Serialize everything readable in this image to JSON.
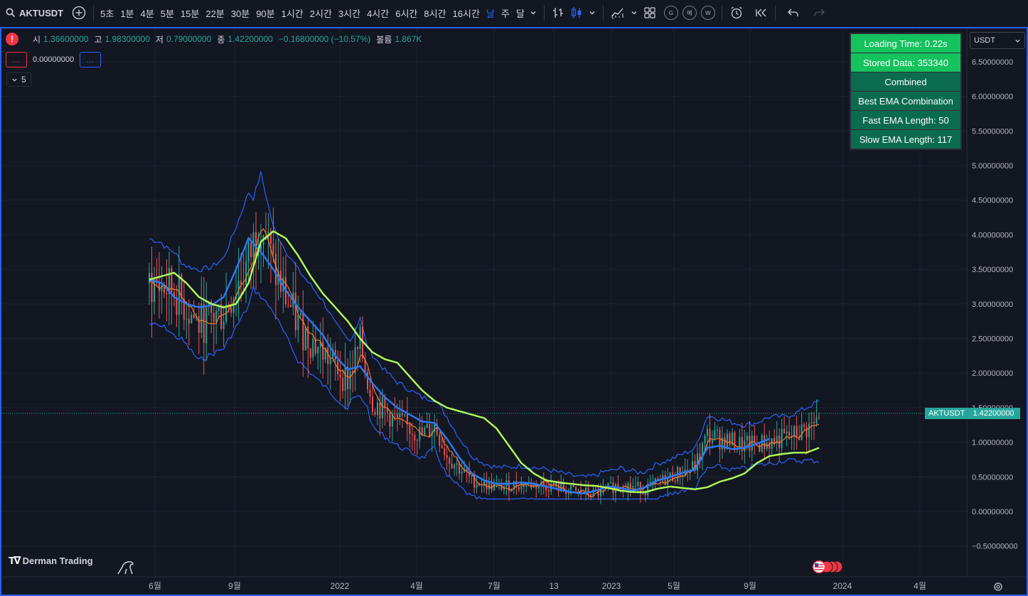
{
  "toolbar": {
    "symbol": "AKTUSDT",
    "intervals": [
      "5초",
      "1분",
      "4분",
      "5분",
      "15분",
      "22분",
      "30분",
      "90분",
      "1시간",
      "2시간",
      "3시간",
      "4시간",
      "6시간",
      "8시간",
      "16시간",
      "날",
      "주",
      "달"
    ],
    "active_interval": "날",
    "circle_buttons": [
      "G",
      "메",
      "W"
    ]
  },
  "legend": {
    "open_label": "시",
    "open_value": "1.36600000",
    "high_label": "고",
    "high_value": "1.98300000",
    "low_label": "저",
    "low_value": "0.79000000",
    "close_label": "종",
    "close_value": "1.42200000",
    "change": "−0.16800000 (−10.57%)",
    "volume_label": "볼륨",
    "volume_value": "1.867K",
    "indicator_value": "0.00000000",
    "dots": "…",
    "collapsed_count": "5"
  },
  "info_table": [
    {
      "text": "Loading Time: 0.22s",
      "style": "green"
    },
    {
      "text": "Stored Data: 353340",
      "style": "green"
    },
    {
      "text": "Combined",
      "style": "dark"
    },
    {
      "text": "Best EMA Combination",
      "style": "dark"
    },
    {
      "text": "Fast EMA Length: 50",
      "style": "dark"
    },
    {
      "text": "Slow EMA Length: 117",
      "style": "dark"
    }
  ],
  "currency": "USDT",
  "price_axis": [
    "6.50000000",
    "6.00000000",
    "5.50000000",
    "5.00000000",
    "4.50000000",
    "4.00000000",
    "3.50000000",
    "3.00000000",
    "2.50000000",
    "2.00000000",
    "1.50000000",
    "1.00000000",
    "0.50000000",
    "0.00000000",
    "−0.50000000"
  ],
  "time_axis": [
    "6월",
    "9월",
    "2022",
    "4월",
    "7월",
    "13",
    "2023",
    "5월",
    "9월",
    "2024",
    "4월"
  ],
  "last_price": {
    "symbol": "AKTUSDT",
    "price": "1.42200000"
  },
  "watermark": "Derman Trading",
  "colors": {
    "up": "#26a69a",
    "down": "#ef5350",
    "ema_green": "#b2ff59",
    "ema_blue": "#2979ff",
    "ema_orange": "#ff7f27",
    "band": "#2962ff",
    "accent": "#2962ff"
  },
  "chart_data": {
    "type": "line",
    "price_range": [
      -0.5,
      6.5
    ],
    "series": [
      {
        "points": [
          [
            0,
            3.35
          ],
          [
            5,
            3.4
          ],
          [
            10,
            3.45
          ],
          [
            15,
            3.3
          ],
          [
            20,
            3.1
          ],
          [
            25,
            3.0
          ],
          [
            30,
            2.95
          ],
          [
            35,
            3.0
          ],
          [
            40,
            3.3
          ],
          [
            45,
            3.9
          ],
          [
            50,
            4.05
          ],
          [
            55,
            3.95
          ],
          [
            60,
            3.7
          ],
          [
            65,
            3.4
          ],
          [
            70,
            3.15
          ],
          [
            75,
            2.95
          ],
          [
            80,
            2.75
          ],
          [
            85,
            2.5
          ],
          [
            90,
            2.3
          ],
          [
            95,
            2.2
          ],
          [
            100,
            2.15
          ],
          [
            105,
            1.95
          ],
          [
            110,
            1.75
          ],
          [
            115,
            1.6
          ],
          [
            120,
            1.5
          ],
          [
            125,
            1.45
          ],
          [
            130,
            1.4
          ],
          [
            135,
            1.35
          ],
          [
            140,
            1.2
          ],
          [
            145,
            0.95
          ],
          [
            150,
            0.7
          ],
          [
            155,
            0.55
          ],
          [
            160,
            0.45
          ],
          [
            165,
            0.42
          ],
          [
            170,
            0.4
          ],
          [
            175,
            0.38
          ],
          [
            180,
            0.37
          ],
          [
            185,
            0.34
          ],
          [
            190,
            0.3
          ],
          [
            195,
            0.28
          ],
          [
            200,
            0.28
          ],
          [
            205,
            0.33
          ],
          [
            210,
            0.36
          ],
          [
            215,
            0.34
          ],
          [
            220,
            0.32
          ],
          [
            225,
            0.35
          ],
          [
            230,
            0.43
          ],
          [
            235,
            0.48
          ],
          [
            240,
            0.55
          ],
          [
            245,
            0.7
          ],
          [
            250,
            0.8
          ],
          [
            255,
            0.83
          ],
          [
            260,
            0.85
          ],
          [
            265,
            0.85
          ],
          [
            270,
            0.92
          ]
        ]
      },
      {
        "points": [
          [
            0,
            3.35
          ],
          [
            5,
            3.3
          ],
          [
            10,
            3.1
          ],
          [
            15,
            3.0
          ],
          [
            20,
            2.95
          ],
          [
            25,
            2.98
          ],
          [
            30,
            3.1
          ],
          [
            35,
            3.5
          ],
          [
            40,
            3.95
          ],
          [
            45,
            3.75
          ],
          [
            50,
            3.5
          ],
          [
            55,
            3.2
          ],
          [
            60,
            2.95
          ],
          [
            65,
            2.75
          ],
          [
            70,
            2.55
          ],
          [
            75,
            2.25
          ],
          [
            80,
            2.05
          ],
          [
            85,
            2.1
          ],
          [
            90,
            1.85
          ],
          [
            95,
            1.65
          ],
          [
            100,
            1.5
          ],
          [
            105,
            1.4
          ],
          [
            110,
            1.3
          ],
          [
            115,
            1.28
          ],
          [
            120,
            1.05
          ],
          [
            125,
            0.78
          ],
          [
            130,
            0.55
          ],
          [
            135,
            0.45
          ],
          [
            140,
            0.4
          ],
          [
            145,
            0.4
          ],
          [
            150,
            0.42
          ],
          [
            155,
            0.4
          ],
          [
            160,
            0.36
          ],
          [
            165,
            0.32
          ],
          [
            170,
            0.28
          ],
          [
            175,
            0.26
          ],
          [
            180,
            0.3
          ],
          [
            185,
            0.36
          ],
          [
            190,
            0.34
          ],
          [
            195,
            0.3
          ],
          [
            200,
            0.35
          ],
          [
            205,
            0.45
          ],
          [
            210,
            0.5
          ],
          [
            215,
            0.56
          ],
          [
            220,
            0.6
          ],
          [
            225,
            0.92
          ],
          [
            230,
            0.95
          ],
          [
            235,
            0.9
          ],
          [
            240,
            0.92
          ],
          [
            245,
            0.98
          ],
          [
            250,
            1.05
          ]
        ]
      },
      {
        "points": [
          [
            0,
            3.3
          ],
          [
            10,
            3.2
          ],
          [
            20,
            2.7
          ],
          [
            30,
            2.9
          ],
          [
            40,
            3.6
          ],
          [
            45,
            4.3
          ],
          [
            50,
            3.5
          ],
          [
            55,
            3.1
          ],
          [
            60,
            2.7
          ],
          [
            70,
            2.3
          ],
          [
            80,
            1.9
          ],
          [
            85,
            2.4
          ],
          [
            90,
            1.6
          ],
          [
            100,
            1.3
          ],
          [
            110,
            1.1
          ],
          [
            115,
            1.25
          ],
          [
            120,
            0.8
          ],
          [
            130,
            0.45
          ],
          [
            140,
            0.35
          ],
          [
            150,
            0.4
          ],
          [
            160,
            0.38
          ],
          [
            170,
            0.3
          ],
          [
            180,
            0.25
          ],
          [
            190,
            0.4
          ],
          [
            200,
            0.32
          ],
          [
            210,
            0.5
          ],
          [
            220,
            0.65
          ],
          [
            225,
            1.1
          ],
          [
            230,
            1.05
          ],
          [
            240,
            0.95
          ],
          [
            250,
            1.0
          ],
          [
            260,
            1.1
          ],
          [
            270,
            1.3
          ]
        ]
      }
    ]
  }
}
